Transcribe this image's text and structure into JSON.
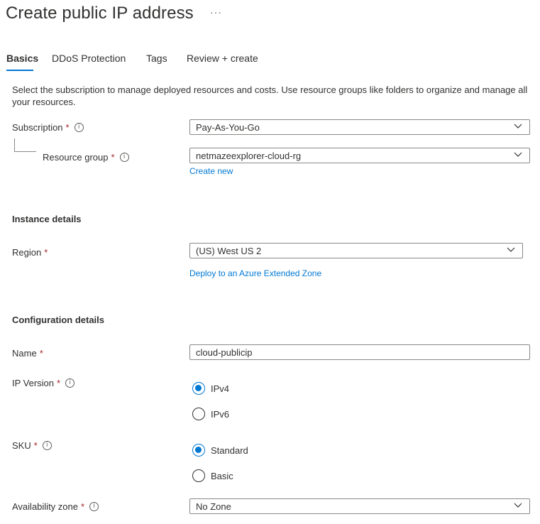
{
  "header": {
    "title": "Create public IP address",
    "more": "···"
  },
  "tabs": [
    {
      "label": "Basics"
    },
    {
      "label": "DDoS Protection"
    },
    {
      "label": "Tags"
    },
    {
      "label": "Review + create"
    }
  ],
  "description": "Select the subscription to manage deployed resources and costs. Use resource groups like folders to organize and manage all your resources.",
  "project": {
    "subscription": {
      "label": "Subscription",
      "value": "Pay-As-You-Go"
    },
    "resource_group": {
      "label": "Resource group",
      "value": "netmazeexplorer-cloud-rg",
      "create_new": "Create new"
    }
  },
  "instance": {
    "heading": "Instance details",
    "region": {
      "label": "Region",
      "value": "(US) West US 2",
      "link": "Deploy to an Azure Extended Zone"
    }
  },
  "config": {
    "heading": "Configuration details",
    "name": {
      "label": "Name",
      "value": "cloud-publicip"
    },
    "ip_version": {
      "label": "IP Version",
      "options": [
        "IPv4",
        "IPv6"
      ],
      "selected": "IPv4"
    },
    "sku": {
      "label": "SKU",
      "options": [
        "Standard",
        "Basic"
      ],
      "selected": "Standard"
    },
    "availability_zone": {
      "label": "Availability zone",
      "value": "No Zone"
    }
  },
  "symbols": {
    "required": "*",
    "info": "i"
  },
  "colors": {
    "accent": "#0078d4",
    "required": "#a4262c",
    "border": "#8a8886"
  },
  "icons": {
    "info": "info-icon",
    "dropdown": "chevron-down-icon",
    "more": "more-icon"
  }
}
